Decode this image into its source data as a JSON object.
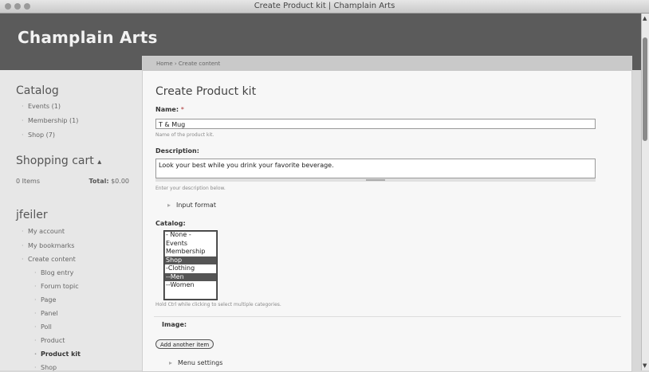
{
  "window": {
    "title": "Create Product kit | Champlain Arts"
  },
  "header": {
    "site_name": "Champlain Arts"
  },
  "breadcrumb": "Home › Create content",
  "sidebar": {
    "catalog": {
      "title": "Catalog",
      "items": [
        "Events (1)",
        "Membership (1)",
        "Shop (7)"
      ]
    },
    "cart": {
      "title": "Shopping cart",
      "toggle": "▴",
      "items_text": "0 Items",
      "total_label": "Total:",
      "total_value": "$0.00"
    },
    "user": {
      "title": "jfeiler",
      "items": [
        "My account",
        "My bookmarks",
        "Create content"
      ],
      "sub_items": [
        "Blog entry",
        "Forum topic",
        "Page",
        "Panel",
        "Poll",
        "Product",
        "Product kit",
        "Shop"
      ],
      "active_sub_item": "Product kit"
    }
  },
  "form": {
    "title": "Create Product kit",
    "name": {
      "label": "Name:",
      "required_marker": "*",
      "value": "T & Mug",
      "help": "Name of the product kit."
    },
    "description": {
      "label": "Description:",
      "value": "Look your best while you drink your favorite beverage.",
      "help": "Enter your description below."
    },
    "input_format": "Input format",
    "catalog": {
      "label": "Catalog:",
      "options": [
        "- None -",
        "Events",
        "Membership",
        "Shop",
        "-Clothing",
        "--Men",
        "--Women"
      ],
      "selected": [
        "Shop",
        "--Men"
      ],
      "help": "Hold Ctrl while clicking to select multiple categories."
    },
    "image": {
      "label": "Image:",
      "add_button": "Add another item"
    },
    "menu_settings": "Menu settings"
  }
}
